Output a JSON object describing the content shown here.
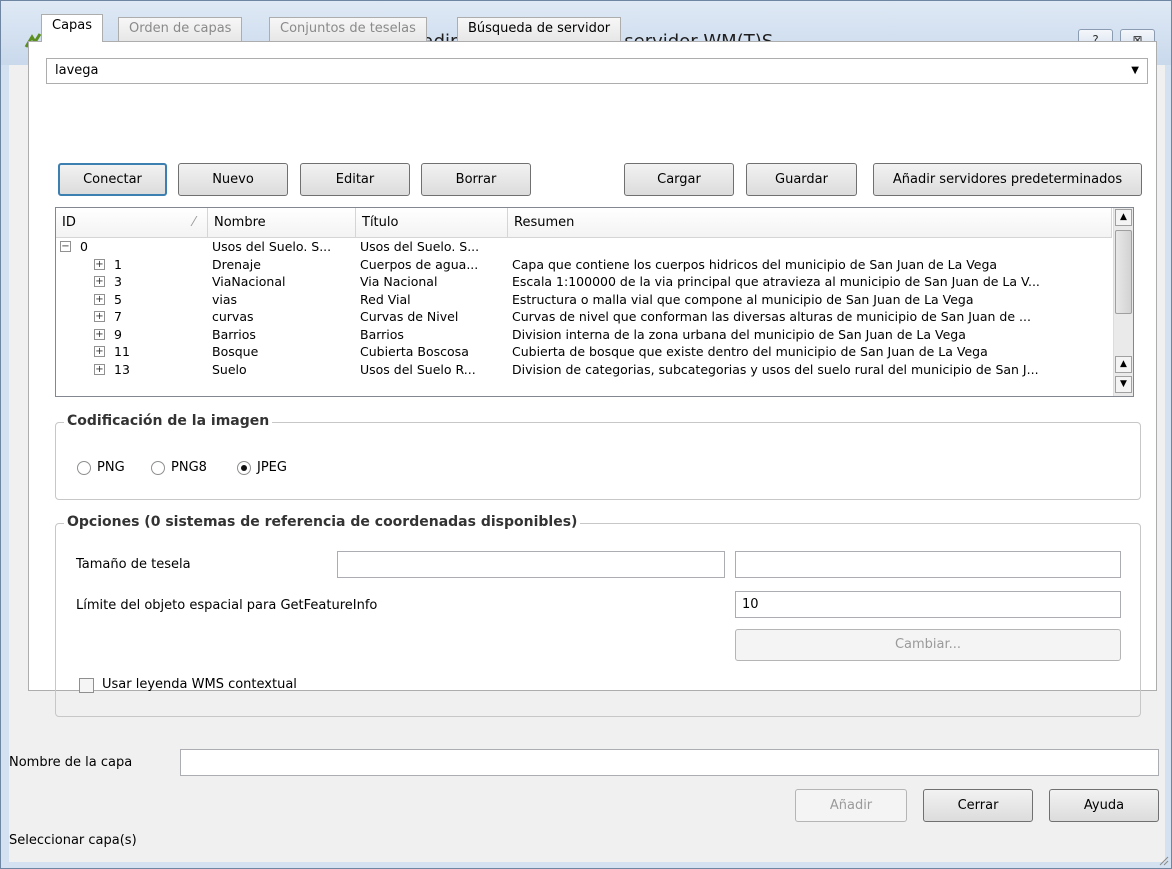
{
  "window": {
    "title": "Añadir capa(s) desde un servidor WM(T)S",
    "help_button": "?",
    "close_button": "⊠"
  },
  "tabs": [
    {
      "label": "Capas",
      "state": "active"
    },
    {
      "label": "Orden de capas",
      "state": "disabled"
    },
    {
      "label": "Conjuntos de teselas",
      "state": "disabled"
    },
    {
      "label": "Búsqueda de servidor",
      "state": "normal"
    }
  ],
  "server_combo": {
    "value": "lavega"
  },
  "buttons": {
    "connect": "Conectar",
    "new": "Nuevo",
    "edit": "Editar",
    "delete": "Borrar",
    "load": "Cargar",
    "save": "Guardar",
    "add_defaults": "Añadir servidores predeterminados"
  },
  "tree": {
    "columns": [
      "ID",
      "Nombre",
      "Título",
      "Resumen"
    ],
    "rows": [
      {
        "id": "0",
        "name": "Usos del Suelo. S...",
        "title": "Usos del Suelo. S...",
        "summary": "",
        "level": 0,
        "expander": "−"
      },
      {
        "id": "1",
        "name": "Drenaje",
        "title": "Cuerpos de agua...",
        "summary": "Capa que contiene los cuerpos hidricos del municipio de San Juan de La Vega",
        "level": 1,
        "expander": "+"
      },
      {
        "id": "3",
        "name": "ViaNacional",
        "title": "Via Nacional",
        "summary": "Escala 1:100000 de la via principal que atravieza al municipio de San Juan de La V...",
        "level": 1,
        "expander": "+"
      },
      {
        "id": "5",
        "name": "vias",
        "title": "Red Vial",
        "summary": "Estructura o malla vial que compone al municipio de San Juan de La Vega",
        "level": 1,
        "expander": "+"
      },
      {
        "id": "7",
        "name": "curvas",
        "title": "Curvas de Nivel",
        "summary": "Curvas de nivel que conforman las diversas alturas de municipio de San Juan de ...",
        "level": 1,
        "expander": "+"
      },
      {
        "id": "9",
        "name": "Barrios",
        "title": "Barrios",
        "summary": "Division interna de la zona urbana del municipio de San Juan de La Vega",
        "level": 1,
        "expander": "+"
      },
      {
        "id": "11",
        "name": "Bosque",
        "title": "Cubierta Boscosa",
        "summary": "Cubierta de bosque que existe dentro del municipio de San Juan de La Vega",
        "level": 1,
        "expander": "+"
      },
      {
        "id": "13",
        "name": "Suelo",
        "title": "Usos del Suelo R...",
        "summary": "Division de categorias, subcategorias y usos del suelo rural del municipio de San J...",
        "level": 1,
        "expander": "+"
      }
    ]
  },
  "encoding": {
    "title": "Codificación de la imagen",
    "options": [
      "PNG",
      "PNG8",
      "JPEG"
    ],
    "selected": "JPEG"
  },
  "options": {
    "title": "Opciones (0 sistemas de referencia de coordenadas disponibles)",
    "tile_size_label": "Tamaño de tesela",
    "tile_width": "",
    "tile_height": "",
    "feature_limit_label": "Límite del objeto espacial para GetFeatureInfo",
    "feature_limit_value": "10",
    "change_button": "Cambiar...",
    "contextual_legend_label": "Usar leyenda WMS contextual",
    "contextual_legend_checked": false
  },
  "layer_name": {
    "label": "Nombre de la capa",
    "value": ""
  },
  "footer": {
    "add": "Añadir",
    "close": "Cerrar",
    "help": "Ayuda",
    "status": "Seleccionar capa(s)"
  }
}
